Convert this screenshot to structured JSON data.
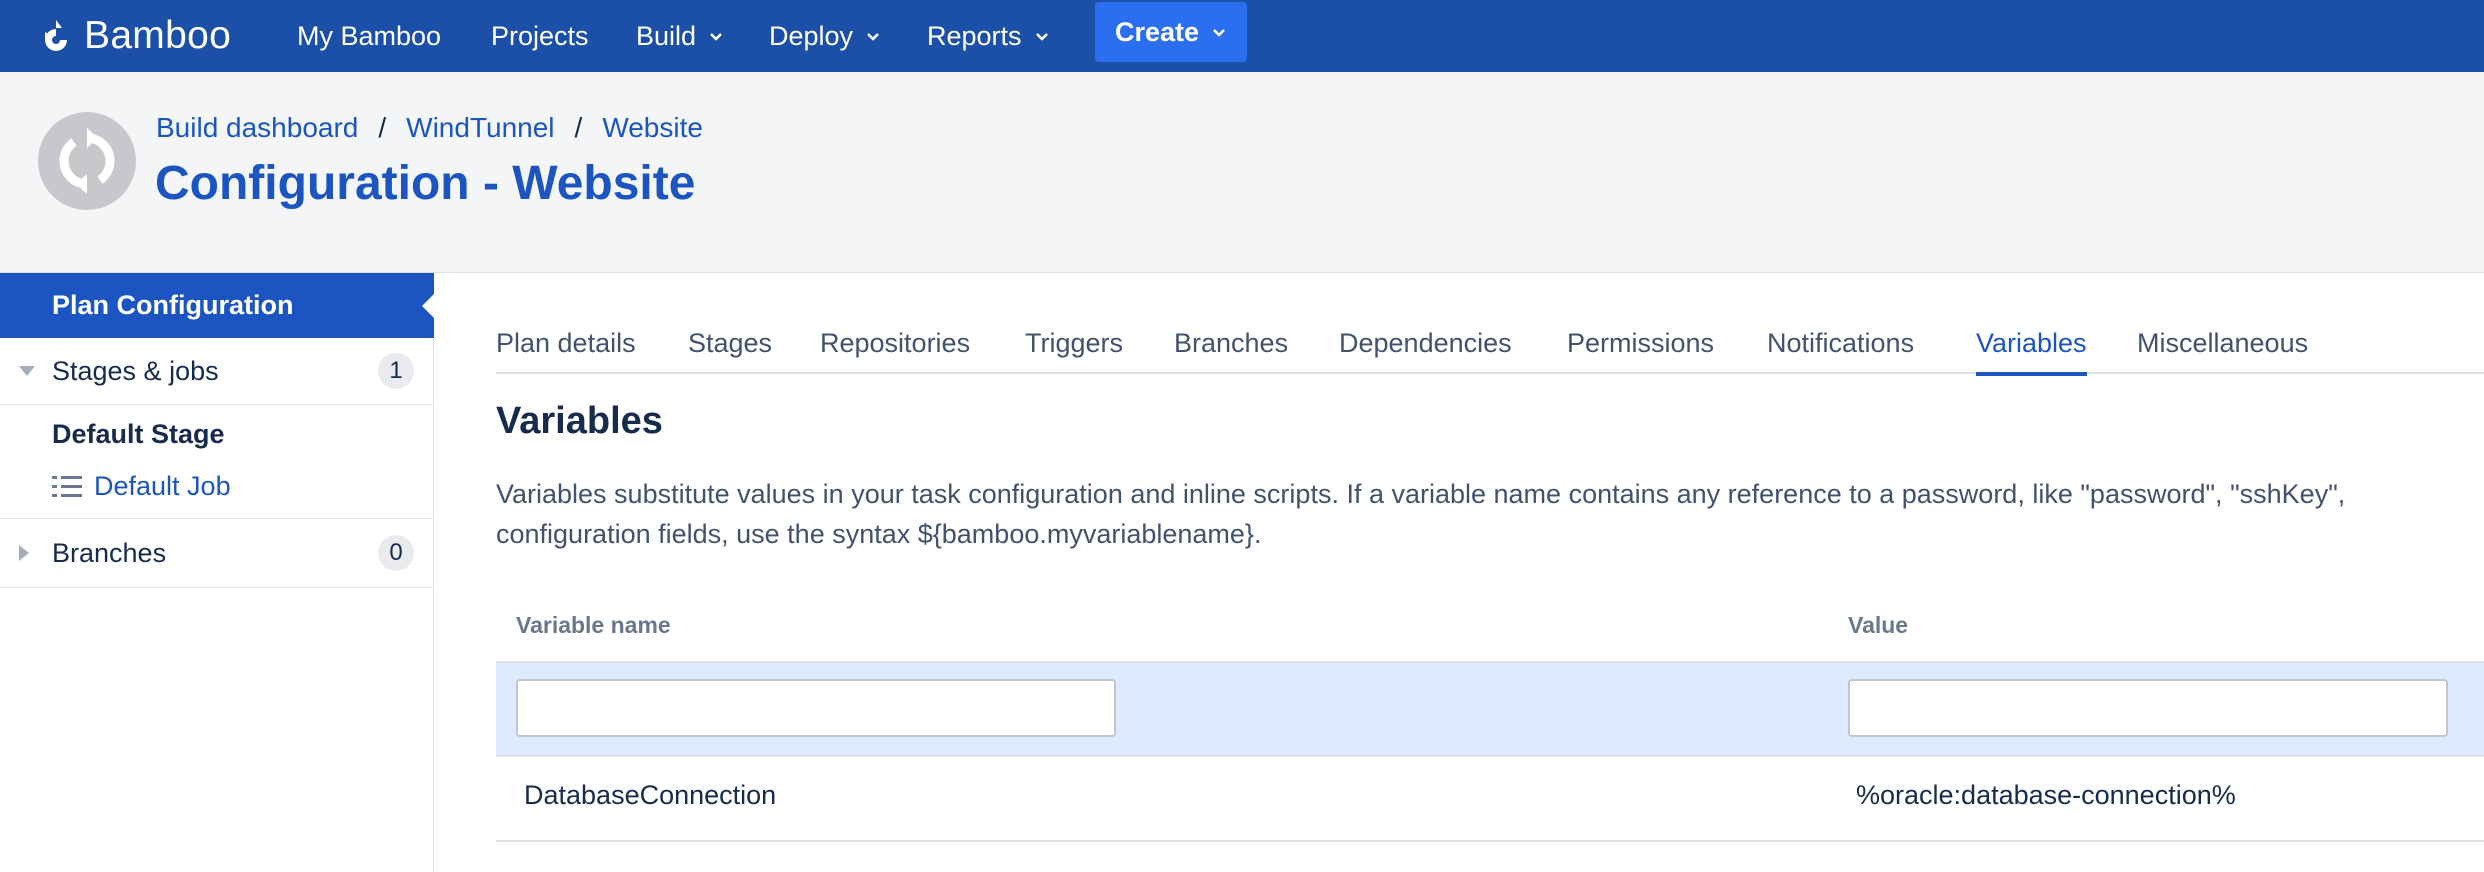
{
  "app": {
    "name": "Bamboo"
  },
  "nav": {
    "items": [
      "My Bamboo",
      "Projects",
      "Build",
      "Deploy",
      "Reports"
    ],
    "create_label": "Create"
  },
  "breadcrumb": {
    "items": [
      "Build dashboard",
      "WindTunnel",
      "Website"
    ],
    "separator": "/"
  },
  "page_title": "Configuration - Website",
  "sidebar": {
    "plan_configuration": "Plan Configuration",
    "stages_jobs": {
      "label": "Stages & jobs",
      "count": "1"
    },
    "stage": "Default Stage",
    "job": "Default Job",
    "branches": {
      "label": "Branches",
      "count": "0"
    }
  },
  "tabs": [
    "Plan details",
    "Stages",
    "Repositories",
    "Triggers",
    "Branches",
    "Dependencies",
    "Permissions",
    "Notifications",
    "Variables",
    "Miscellaneous"
  ],
  "active_tab": "Variables",
  "section": {
    "title": "Variables",
    "description_line1": "Variables substitute values in your task configuration and inline scripts. If a variable name contains any reference to a password, like \"password\", \"sshKey\",",
    "description_line2": "configuration fields, use the syntax ${bamboo.myvariablename}."
  },
  "table": {
    "headers": [
      "Variable name",
      "Value"
    ],
    "new_name_value": "",
    "new_value_value": "",
    "rows": [
      {
        "name": "DatabaseConnection",
        "value": "%oracle:database-connection%"
      }
    ]
  },
  "colors": {
    "nav_bg": "#1c4fa8",
    "create_bg": "#2b6ff0",
    "accent": "#1c55c2",
    "input_row_bg": "#deebff"
  }
}
